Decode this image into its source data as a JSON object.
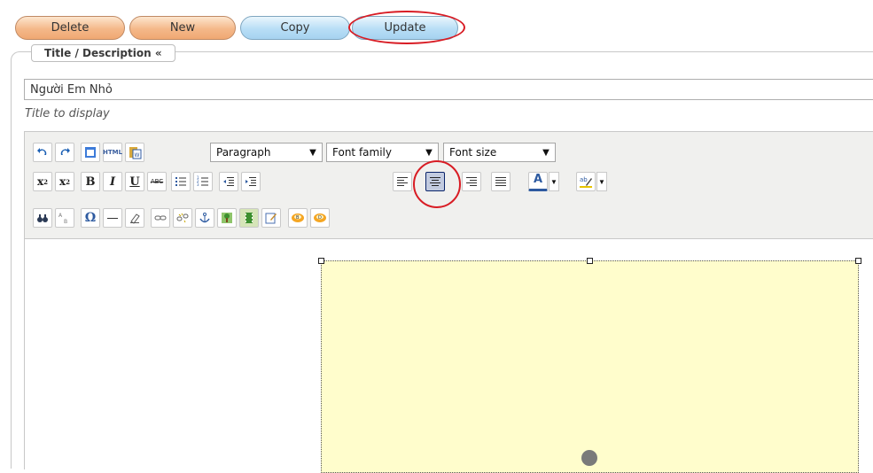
{
  "actions": {
    "delete": "Delete",
    "new": "New",
    "copy": "Copy",
    "update": "Update"
  },
  "section": {
    "legend": "Title / Description «",
    "title_value": "Người Em Nhỏ",
    "title_hint": "Title to display"
  },
  "toolbar": {
    "html_label": "HTML",
    "format_select": "Paragraph",
    "font_family_select": "Font family",
    "font_size_select": "Font size",
    "bold": "B",
    "italic": "I",
    "underline": "U",
    "strikethrough": "ABC",
    "omega": "Ω",
    "font_color_letter": "A",
    "active_button": "align-center"
  },
  "colors": {
    "orange_button": "#f4b88a",
    "blue_button": "#b8def6",
    "highlight_circle": "#d81c24",
    "placeholder_box": "#fffdcc",
    "toolbar_bg": "#f0f0ee"
  }
}
